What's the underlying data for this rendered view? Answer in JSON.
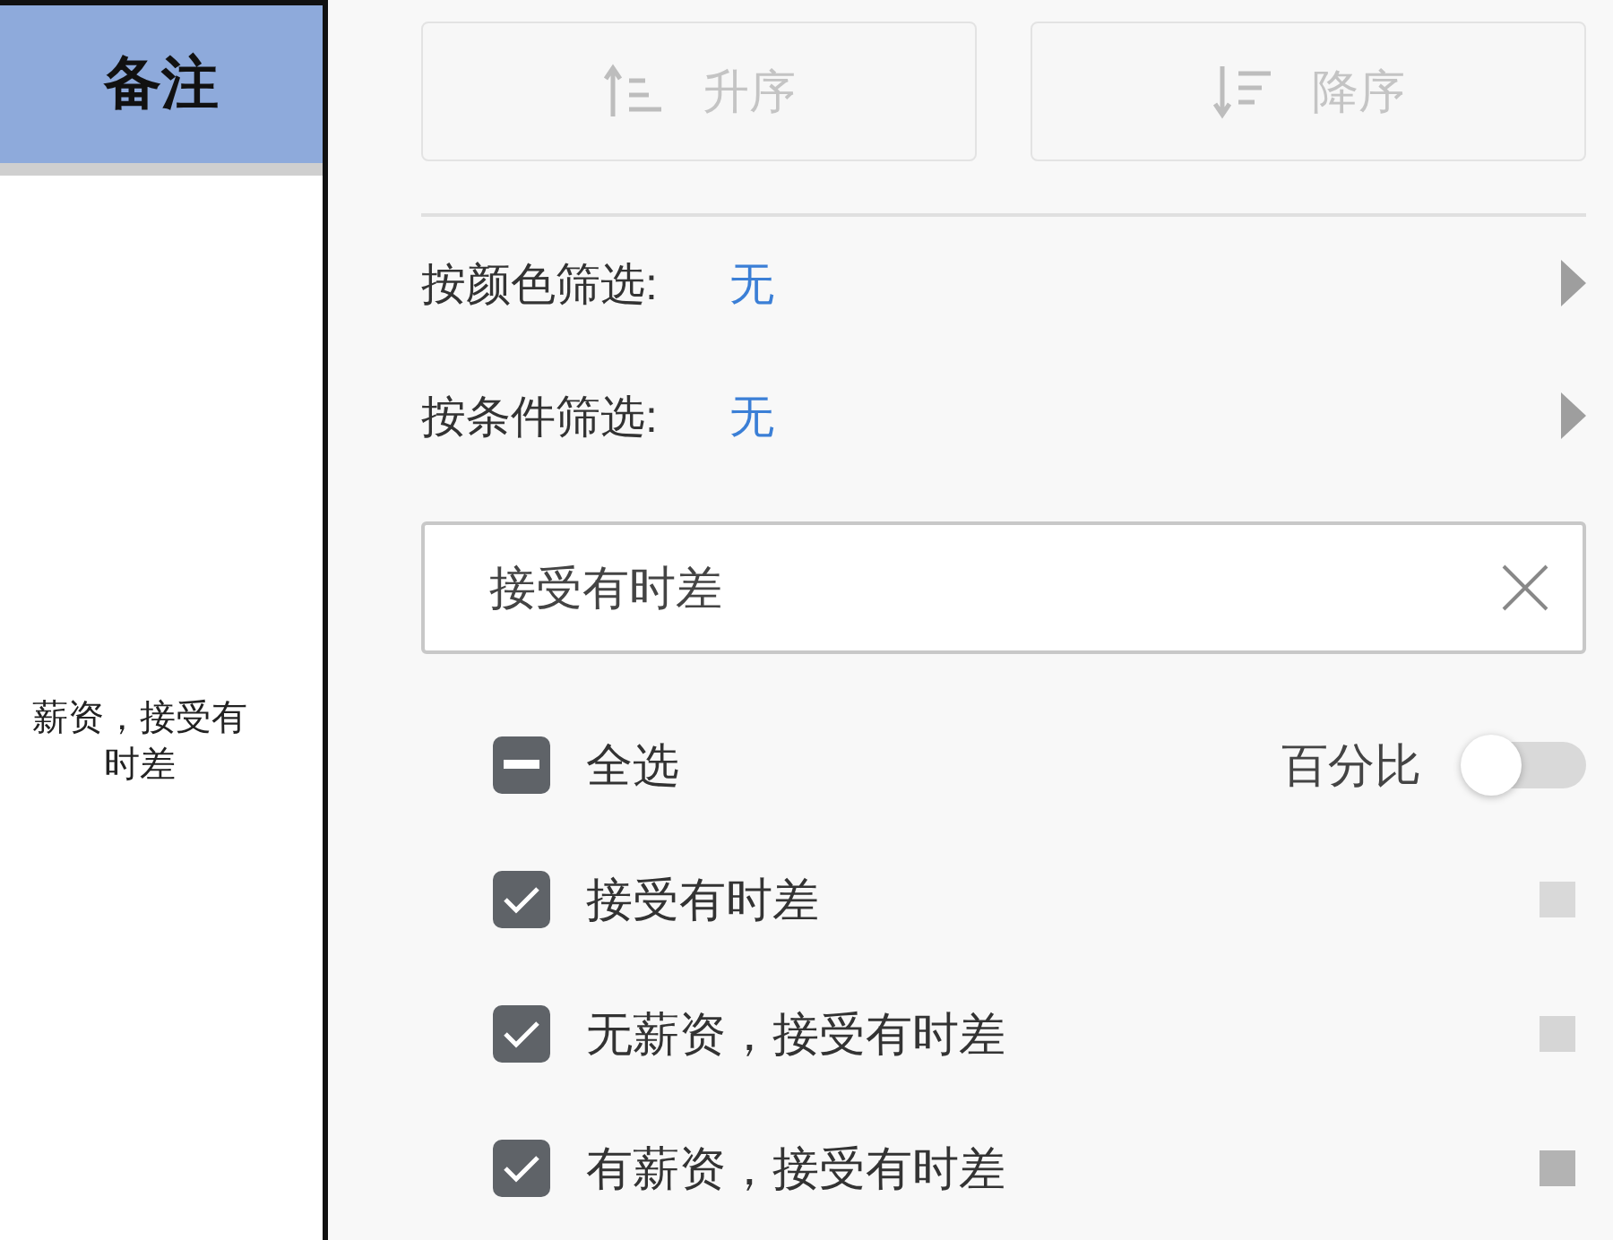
{
  "sheet": {
    "header": "备注",
    "cell": "薪资，接受有时差"
  },
  "sort_buttons": [
    {
      "kind": "asc",
      "label": "升序"
    },
    {
      "kind": "desc",
      "label": "降序"
    }
  ],
  "filters": [
    {
      "label": "按颜色筛选:",
      "value": "无"
    },
    {
      "label": "按条件筛选:",
      "value": "无"
    }
  ],
  "search": {
    "value": "接受有时差"
  },
  "select_all": {
    "label": "全选",
    "indeterminate": true
  },
  "percent_toggle": {
    "label": "百分比",
    "on": false
  },
  "items": [
    {
      "label": "接受有时差",
      "checked": true,
      "color": "#d9d9d9"
    },
    {
      "label": "无薪资，接受有时差",
      "checked": true,
      "color": "#d6d6d6"
    },
    {
      "label": "有薪资，接受有时差",
      "checked": true,
      "color": "#b3b3b3"
    }
  ]
}
